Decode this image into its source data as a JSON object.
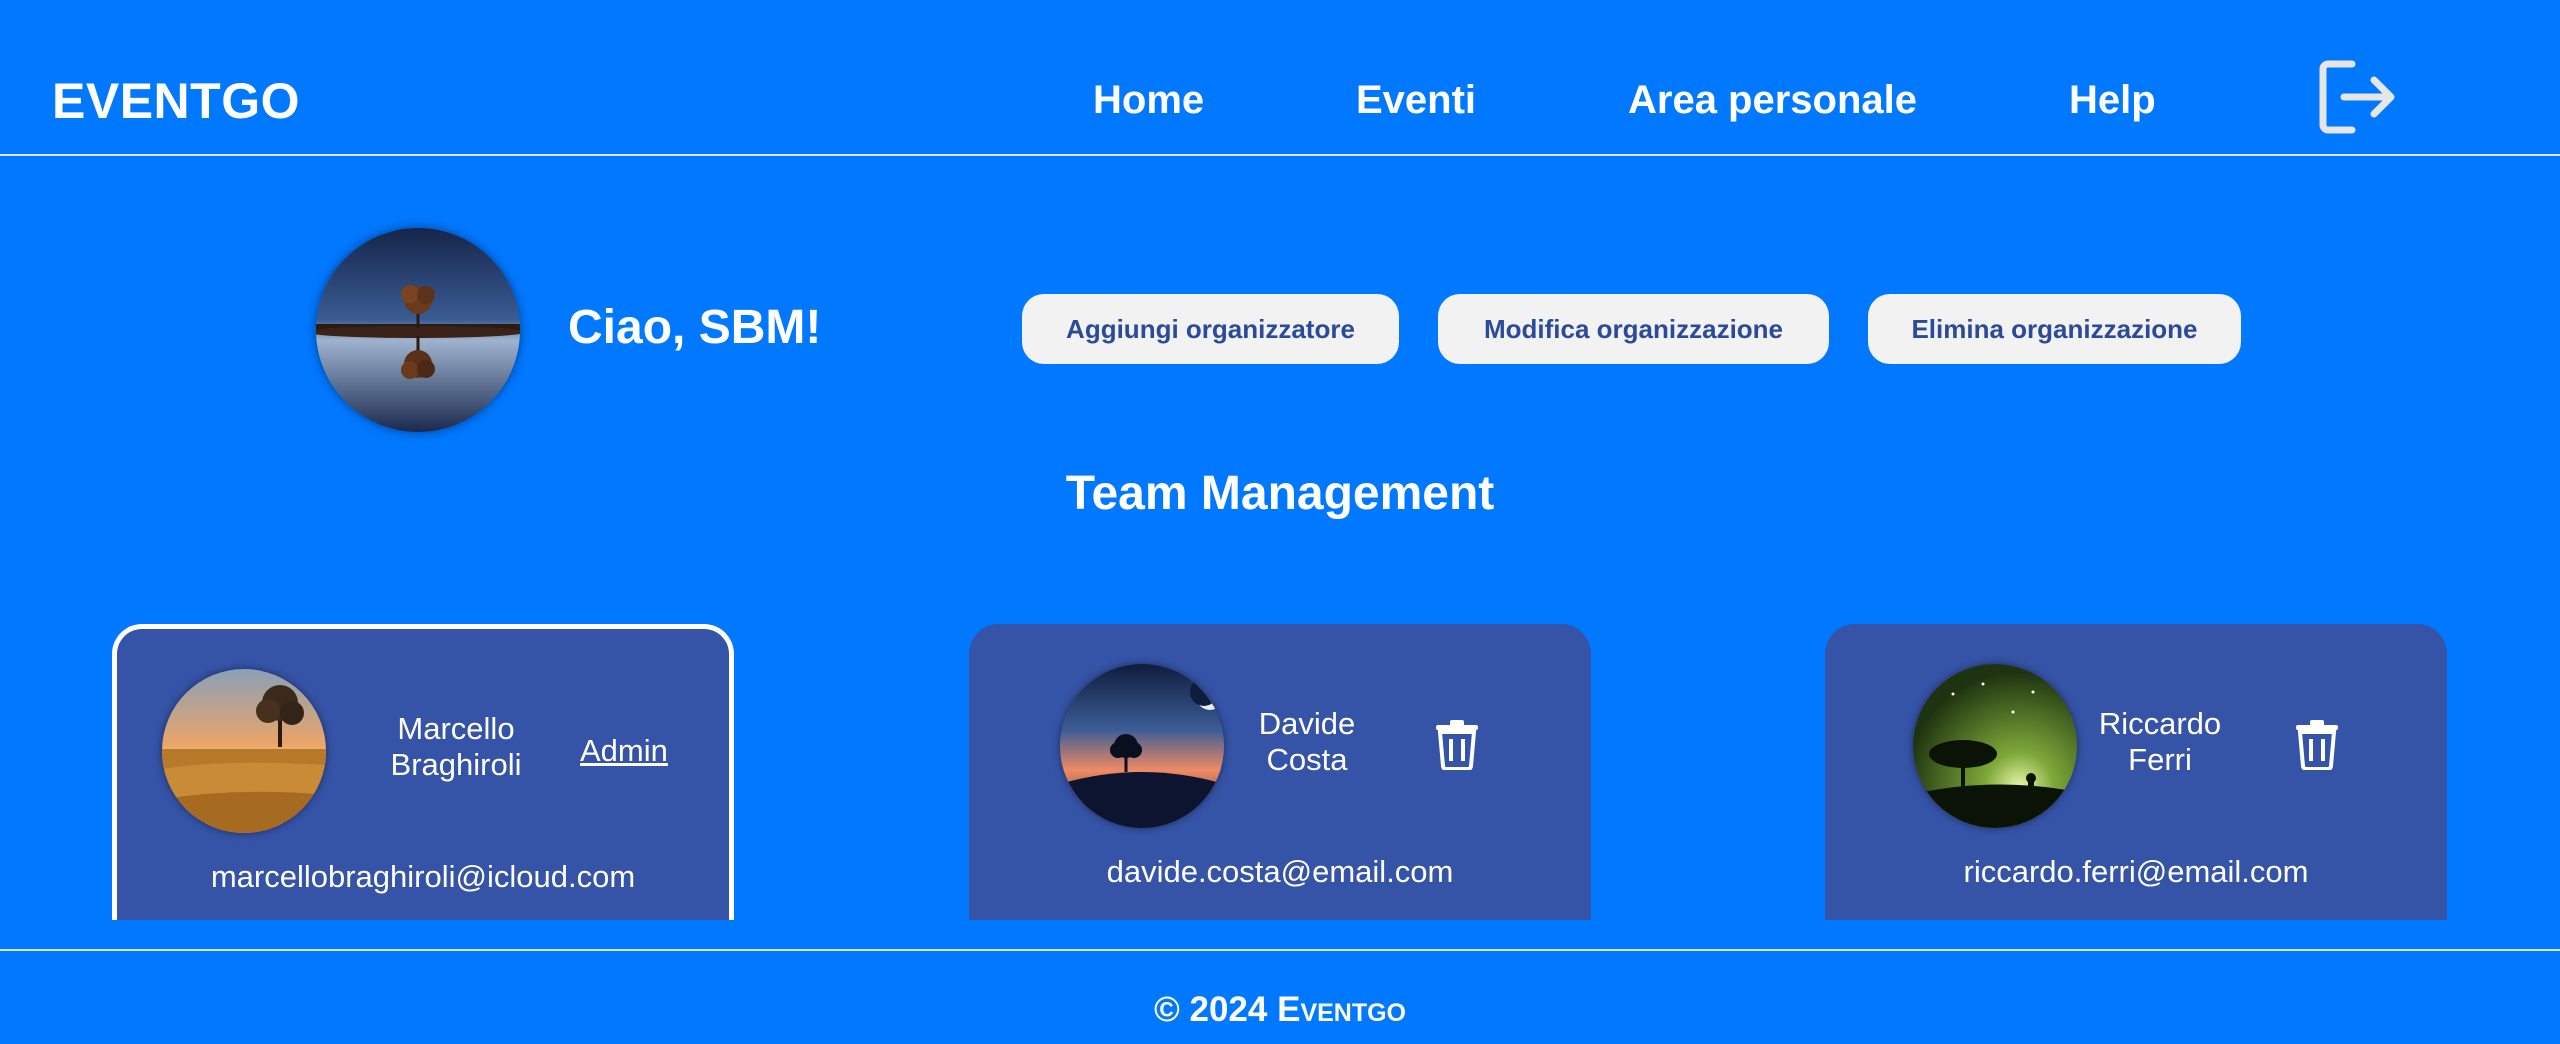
{
  "header": {
    "brand": "EVENTGO",
    "nav": {
      "home": "Home",
      "eventi": "Eventi",
      "area_personale": "Area personale",
      "help": "Help"
    },
    "logout_icon": "logout-icon"
  },
  "profile": {
    "greeting": "Ciao, SBM!",
    "avatar": "tree-reflection-photo"
  },
  "actions": {
    "add": "Aggiungi organizzatore",
    "edit": "Modifica organizzazione",
    "delete": "Elimina organizzazione"
  },
  "team": {
    "title": "Team Management",
    "members": [
      {
        "first_name": "Marcello",
        "last_name": "Braghiroli",
        "email": "marcellobraghiroli@icloud.com",
        "role": "Admin",
        "selected": true
      },
      {
        "first_name": "Davide",
        "last_name": "Costa",
        "email": "davide.costa@email.com",
        "action_icon": "trash-icon"
      },
      {
        "first_name": "Riccardo",
        "last_name": "Ferri",
        "email": "riccardo.ferri@email.com",
        "action_icon": "trash-icon"
      }
    ]
  },
  "footer": {
    "copyright": "© 2024",
    "brand": "Eventgo"
  },
  "colors": {
    "background": "#0078ff",
    "card": "#3553a7",
    "button_bg": "#f2f2f2",
    "button_text": "#2b4a9a"
  }
}
